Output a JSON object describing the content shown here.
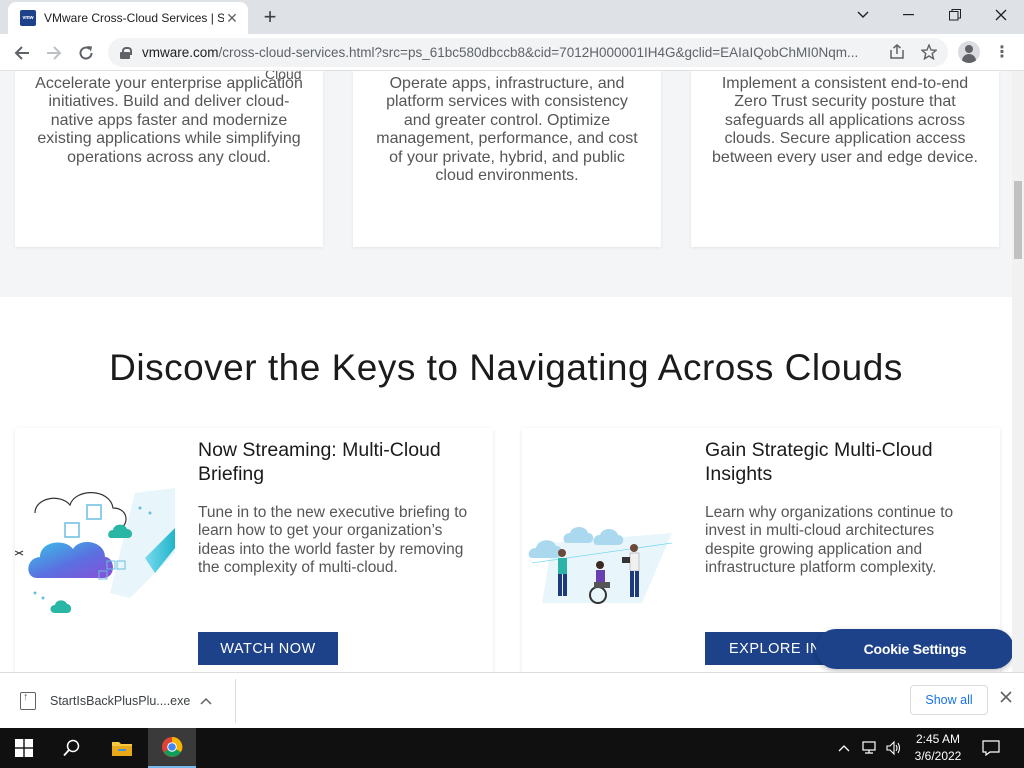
{
  "browser": {
    "tab_title": "VMware Cross-Cloud Services | S",
    "tab_favicon": "vmw",
    "url_host": "vmware.com",
    "url_rest": "/cross-cloud-services.html?src=ps_61bc580dbccb8&cid=7012H000001IH4G&gclid=EAIaIQobChMI0Nqm...",
    "new_tab": "+",
    "close_tab": "✕"
  },
  "page": {
    "feature_cards": [
      {
        "text": "Accelerate your enterprise application initiatives. Build and deliver cloud-native apps faster and modernize existing applications while simplifying operations across any cloud.",
        "overflow_label": "Cloud"
      },
      {
        "text": "Operate apps, infrastructure, and platform services with consistency and greater control. Optimize management, performance, and cost of your private, hybrid, and public cloud environments."
      },
      {
        "text": "Implement a consistent end-to-end Zero Trust security posture that safeguards all applications across clouds. Secure application access between every user and edge device."
      }
    ],
    "section_title": "Discover the Keys to Navigating Across Clouds",
    "promo_cards": [
      {
        "heading": "Now Streaming: Multi-Cloud Briefing",
        "text": "Tune in to the new executive briefing to learn how to get your organization’s ideas into the world faster by removing the complexity of multi-cloud.",
        "button": "WATCH NOW"
      },
      {
        "heading": "Gain Strategic Multi-Cloud Insights",
        "text": "Learn why organizations continue to invest in multi-cloud architectures despite growing application and infrastructure platform complexity.",
        "button": "EXPLORE IN"
      }
    ],
    "cookie_button": "Cookie Settings"
  },
  "downloads": {
    "file_name": "StartIsBackPlusPlu....exe",
    "show_all": "Show all"
  },
  "taskbar": {
    "time": "2:45 AM",
    "date": "3/6/2022"
  },
  "colors": {
    "brand": "#1d428a",
    "band": "#f4f5f7",
    "taskbar": "#101010"
  }
}
